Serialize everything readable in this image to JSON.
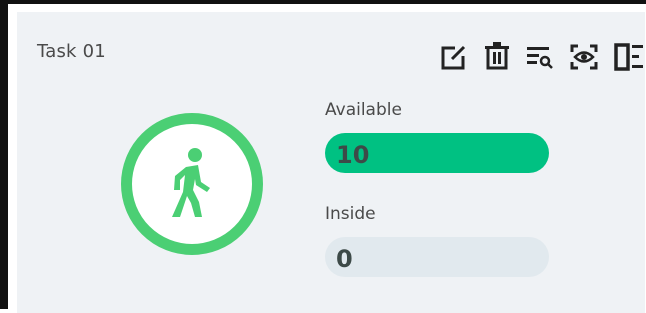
{
  "task": {
    "title": "Task 01"
  },
  "toolbar": [
    {
      "icon": "edit-icon"
    },
    {
      "icon": "trash-icon"
    },
    {
      "icon": "search-list-icon"
    },
    {
      "icon": "eye-scan-icon"
    },
    {
      "icon": "panel-list-icon"
    }
  ],
  "status": {
    "icon": "walking-person-icon",
    "ring_color": "#4bcf74"
  },
  "stats": {
    "available": {
      "label": "Available",
      "value": "10",
      "color": "#00c182"
    },
    "inside": {
      "label": "Inside",
      "value": "0",
      "color": "#e1e9ee"
    }
  }
}
